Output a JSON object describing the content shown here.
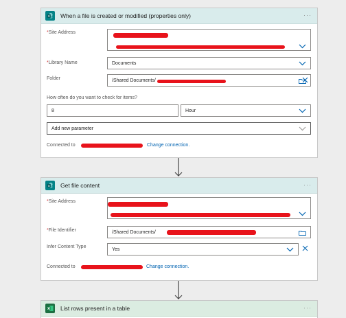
{
  "cards": [
    {
      "title": "When a file is created or modified (properties only)",
      "icon": "sharepoint-icon",
      "site_label": "Site Address",
      "library_label": "Library Name",
      "library_value": "Documents",
      "folder_label": "Folder",
      "folder_value": "/Shared Documents/",
      "frequency_label": "How often do you want to check for items?",
      "interval_value": "8",
      "unit_value": "Hour",
      "add_param": "Add new parameter",
      "connected_to": "Connected to",
      "change_connection": "Change connection."
    },
    {
      "title": "Get file content",
      "icon": "sharepoint-icon",
      "site_label": "Site Address",
      "file_label": "File Identifier",
      "file_value": "/Shared Documents/",
      "infer_label": "Infer Content Type",
      "infer_value": "Yes",
      "connected_to": "Connected to",
      "change_connection": "Change connection."
    },
    {
      "title": "List rows present in a table",
      "icon": "excel-icon"
    }
  ],
  "more_symbol": "···",
  "required_mark": "*",
  "colors": {
    "sharepoint": "#038387",
    "excel": "#1d6f42",
    "redaction": "#e8131b",
    "link": "#0063b1"
  }
}
